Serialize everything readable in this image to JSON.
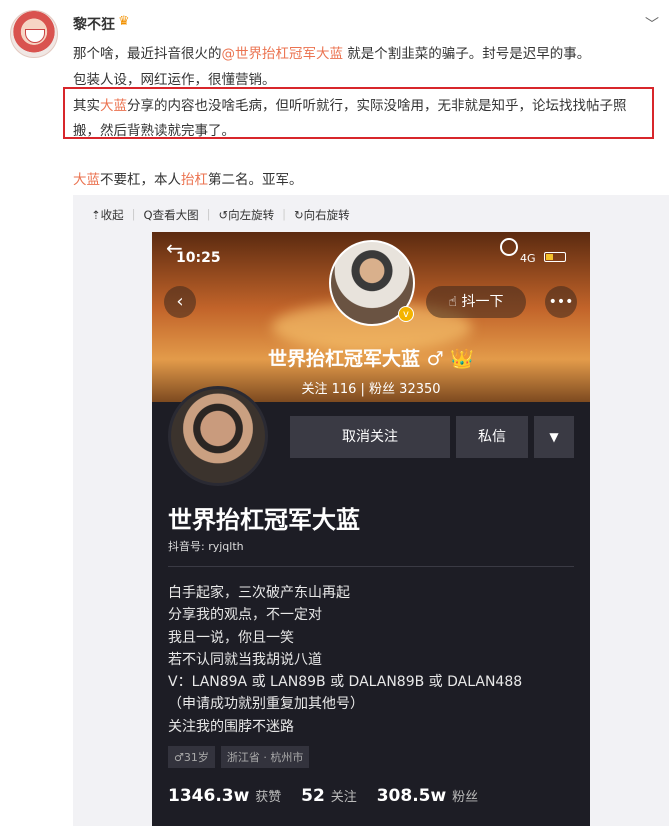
{
  "post": {
    "username": "黎不狂",
    "line1_before": "那个啥，最近抖音很火的",
    "line1_mention": "@世界抬杠冠军大蓝",
    "line1_after": " 就是个割韭菜的骗子。封号是迟早的事。",
    "line2": "包装人设，网红运作，很懂营销。",
    "line3_before": "其实",
    "line3_hl": "大蓝",
    "line3_after": "分享的内容也没啥毛病，但听听就行，实际没啥用，无非就是知乎，论坛找找帖子照",
    "line4": "搬，然后背熟读就完事了。",
    "line5_hl1": "大蓝",
    "line5_mid": "不要杠，本人",
    "line5_hl2": "抬杠",
    "line5_after": "第二名。亚军。"
  },
  "toolbar": {
    "collapse": "⇡收起",
    "view_large": "Q查看大图",
    "rotate_left": "↺向左旋转",
    "rotate_right": "↻向右旋转"
  },
  "screenshot": {
    "time": "10:25",
    "network": "4G",
    "shake_button": "☝ 抖一下",
    "hero_name": "世界抬杠冠军大蓝 ♂ 👑",
    "hero_stats": "关注  116   |   粉丝  32350",
    "unfollow": "取消关注",
    "message": "私信",
    "display_name": "世界抬杠冠军大蓝",
    "douyin_id": "抖音号: ryjqlth",
    "bio": "白手起家，三次破产东山再起\n分享我的观点，不一定对\n我且一说，你且一笑\n若不认同就当我胡说八道\nV：LAN89A 或 LAN89B 或 DALAN89B 或 DALAN488\n（申请成功就别重复加其他号）\n关注我的围脖不迷路",
    "age_tag": "♂31岁",
    "location_tag": "浙江省 · 杭州市",
    "likes_num": "1346.3w",
    "likes_label": "获赞",
    "following_num": "52",
    "following_label": "关注",
    "fans_num": "308.5w",
    "fans_label": "粉丝"
  }
}
